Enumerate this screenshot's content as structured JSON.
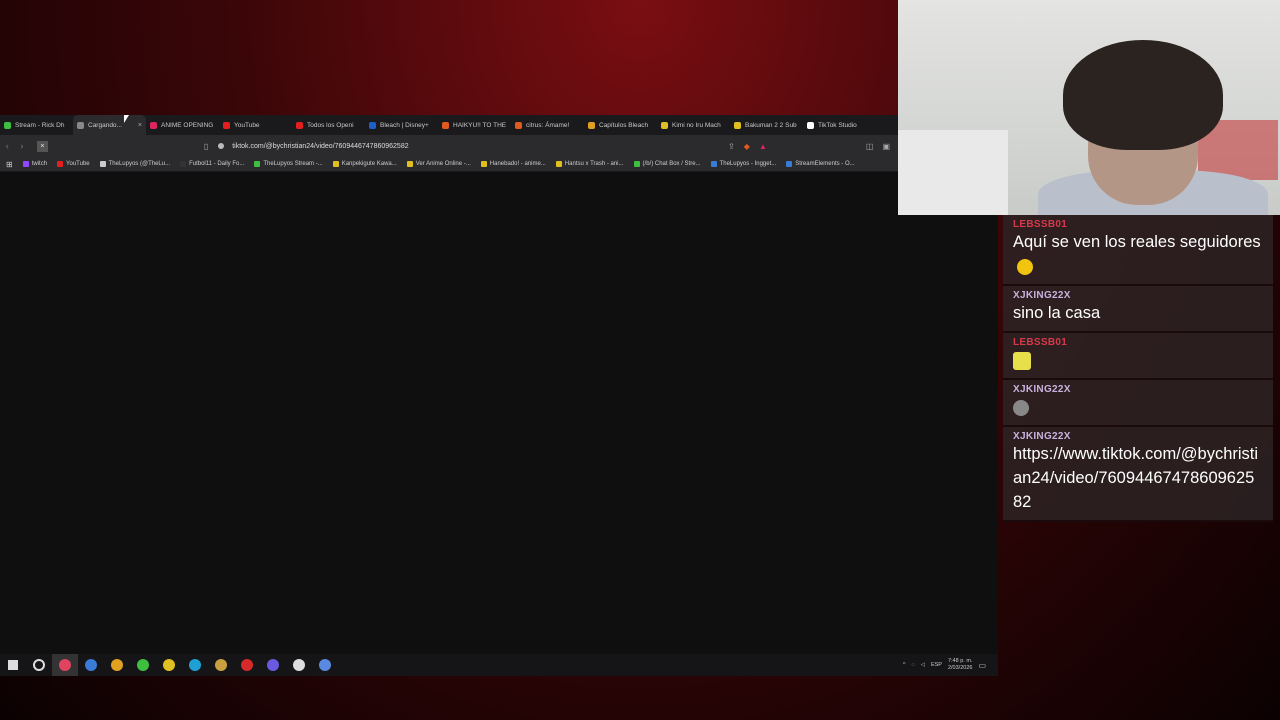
{
  "browser": {
    "tabs": [
      {
        "label": "Stream - Rick Dh",
        "color": "#3fbf3f"
      },
      {
        "label": "Cargando...",
        "color": "#888888",
        "active": true
      },
      {
        "label": "ANIME OPENING",
        "color": "#e0245e"
      },
      {
        "label": "YouTube",
        "color": "#e02020"
      },
      {
        "label": "Todos los Openi",
        "color": "#e02020"
      },
      {
        "label": "Bleach | Disney+",
        "color": "#1e5fc8"
      },
      {
        "label": "HAIKYU!! TO THE",
        "color": "#e05a20"
      },
      {
        "label": "citrus: Ámame!",
        "color": "#e05a20"
      },
      {
        "label": "Capítulos Bleach",
        "color": "#e0a020"
      },
      {
        "label": "Kimi no Iru Mach",
        "color": "#e0c020"
      },
      {
        "label": "Bakuman 2 2 Sub",
        "color": "#e0c020"
      },
      {
        "label": "TikTok Studio",
        "color": "#ffffff"
      }
    ],
    "close_symbol": "×",
    "url": "tiktok.com/@bychristian24/video/7609446747860962582",
    "bookmarks": [
      {
        "label": "twitch",
        "color": "#9146ff"
      },
      {
        "label": "YouTube",
        "color": "#e02020"
      },
      {
        "label": "TheLupyos (@TheLu...",
        "color": "#cccccc"
      },
      {
        "label": "Futbol11 - Daily Fo...",
        "color": "#333333"
      },
      {
        "label": "TheLupyos Stream -...",
        "color": "#3fbf3f"
      },
      {
        "label": "Kanpekigute Kawa...",
        "color": "#e0c020"
      },
      {
        "label": "Ver Anime Online -...",
        "color": "#e0c020"
      },
      {
        "label": "Hanebado! - anime...",
        "color": "#e0c020"
      },
      {
        "label": "Hantsu x Trash - ani...",
        "color": "#e0c020"
      },
      {
        "label": "(/b/) Chat Box / Stre...",
        "color": "#3fbf3f"
      },
      {
        "label": "TheLupyos - Ingget...",
        "color": "#3a7bd5"
      },
      {
        "label": "StreamElements - O...",
        "color": "#3a7bd5"
      }
    ]
  },
  "taskbar": {
    "language": "ESP",
    "time": "7:48 p. m.",
    "date": "2/03/2026",
    "icon_colors": [
      "#e0445e",
      "#3a7bd5",
      "#e0a020",
      "#3fbf3f",
      "#e0c020",
      "#1ea0d5",
      "#c8a040",
      "#d62a2a",
      "#6a5adf",
      "#dddddd",
      "#5a8adf"
    ]
  },
  "chat": {
    "messages": [
      {
        "user": "LEBSSB01",
        "user_style": "red",
        "text": "Aquí se ven los reales seguidores",
        "emoji": true
      },
      {
        "user": "XJKING22X",
        "text": "sino la casa"
      },
      {
        "user": "LEBSSB01",
        "user_style": "red",
        "text": "",
        "emote": "yellow"
      },
      {
        "user": "XJKING22X",
        "text": "",
        "emote": "cat"
      },
      {
        "user": "XJKING22X",
        "text": "https://www.tiktok.com/@bychristian24/video/7609446747860962582"
      }
    ]
  }
}
